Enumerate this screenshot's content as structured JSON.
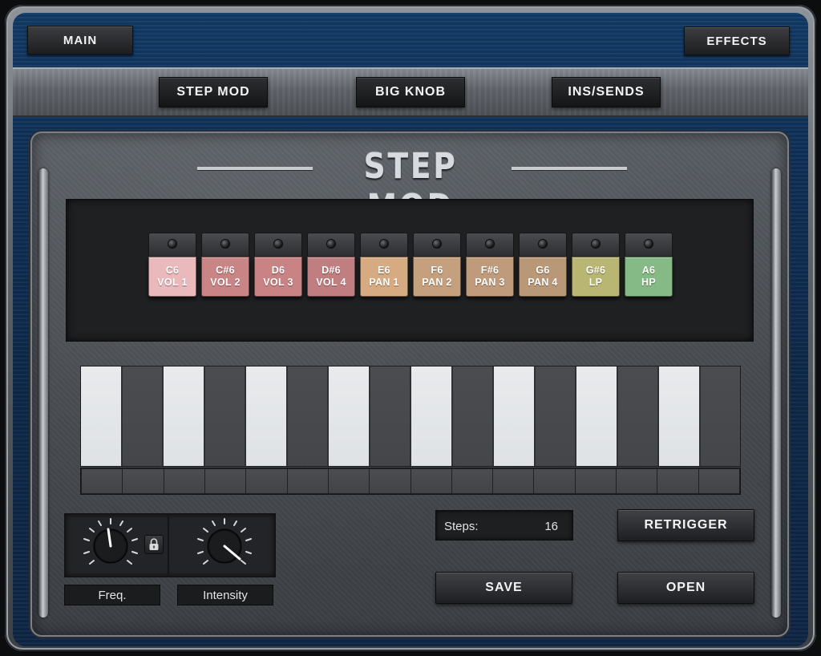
{
  "header": {
    "main_label": "MAIN",
    "effects_label": "EFFECTS"
  },
  "tabs": [
    {
      "label": "STEP MOD"
    },
    {
      "label": "BIG KNOB"
    },
    {
      "label": "INS/SENDS"
    }
  ],
  "panel": {
    "title": "STEP MOD"
  },
  "pads": [
    {
      "note": "C6",
      "param": "VOL 1",
      "color": "#e9b9bb"
    },
    {
      "note": "C#6",
      "param": "VOL 2",
      "color": "#c98585"
    },
    {
      "note": "D6",
      "param": "VOL 3",
      "color": "#c98384"
    },
    {
      "note": "D#6",
      "param": "VOL 4",
      "color": "#c17e80"
    },
    {
      "note": "E6",
      "param": "PAN 1",
      "color": "#d6ab82"
    },
    {
      "note": "F6",
      "param": "PAN 2",
      "color": "#c4a07f"
    },
    {
      "note": "F#6",
      "param": "PAN 3",
      "color": "#c09b7b"
    },
    {
      "note": "G6",
      "param": "PAN 4",
      "color": "#b99878"
    },
    {
      "note": "G#6",
      "param": "LP",
      "color": "#b9b573"
    },
    {
      "note": "A6",
      "param": "HP",
      "color": "#85b985"
    }
  ],
  "step_values": [
    1,
    0,
    1,
    0,
    1,
    0,
    1,
    0,
    1,
    0,
    1,
    0,
    1,
    0,
    1,
    0
  ],
  "knobs": {
    "freq": {
      "label": "Freq.",
      "icon": "lock-icon"
    },
    "intensity": {
      "label": "Intensity"
    }
  },
  "controls": {
    "steps_label": "Steps:",
    "steps_value": "16",
    "retrigger_label": "RETRIGGER",
    "save_label": "SAVE",
    "open_label": "OPEN"
  }
}
